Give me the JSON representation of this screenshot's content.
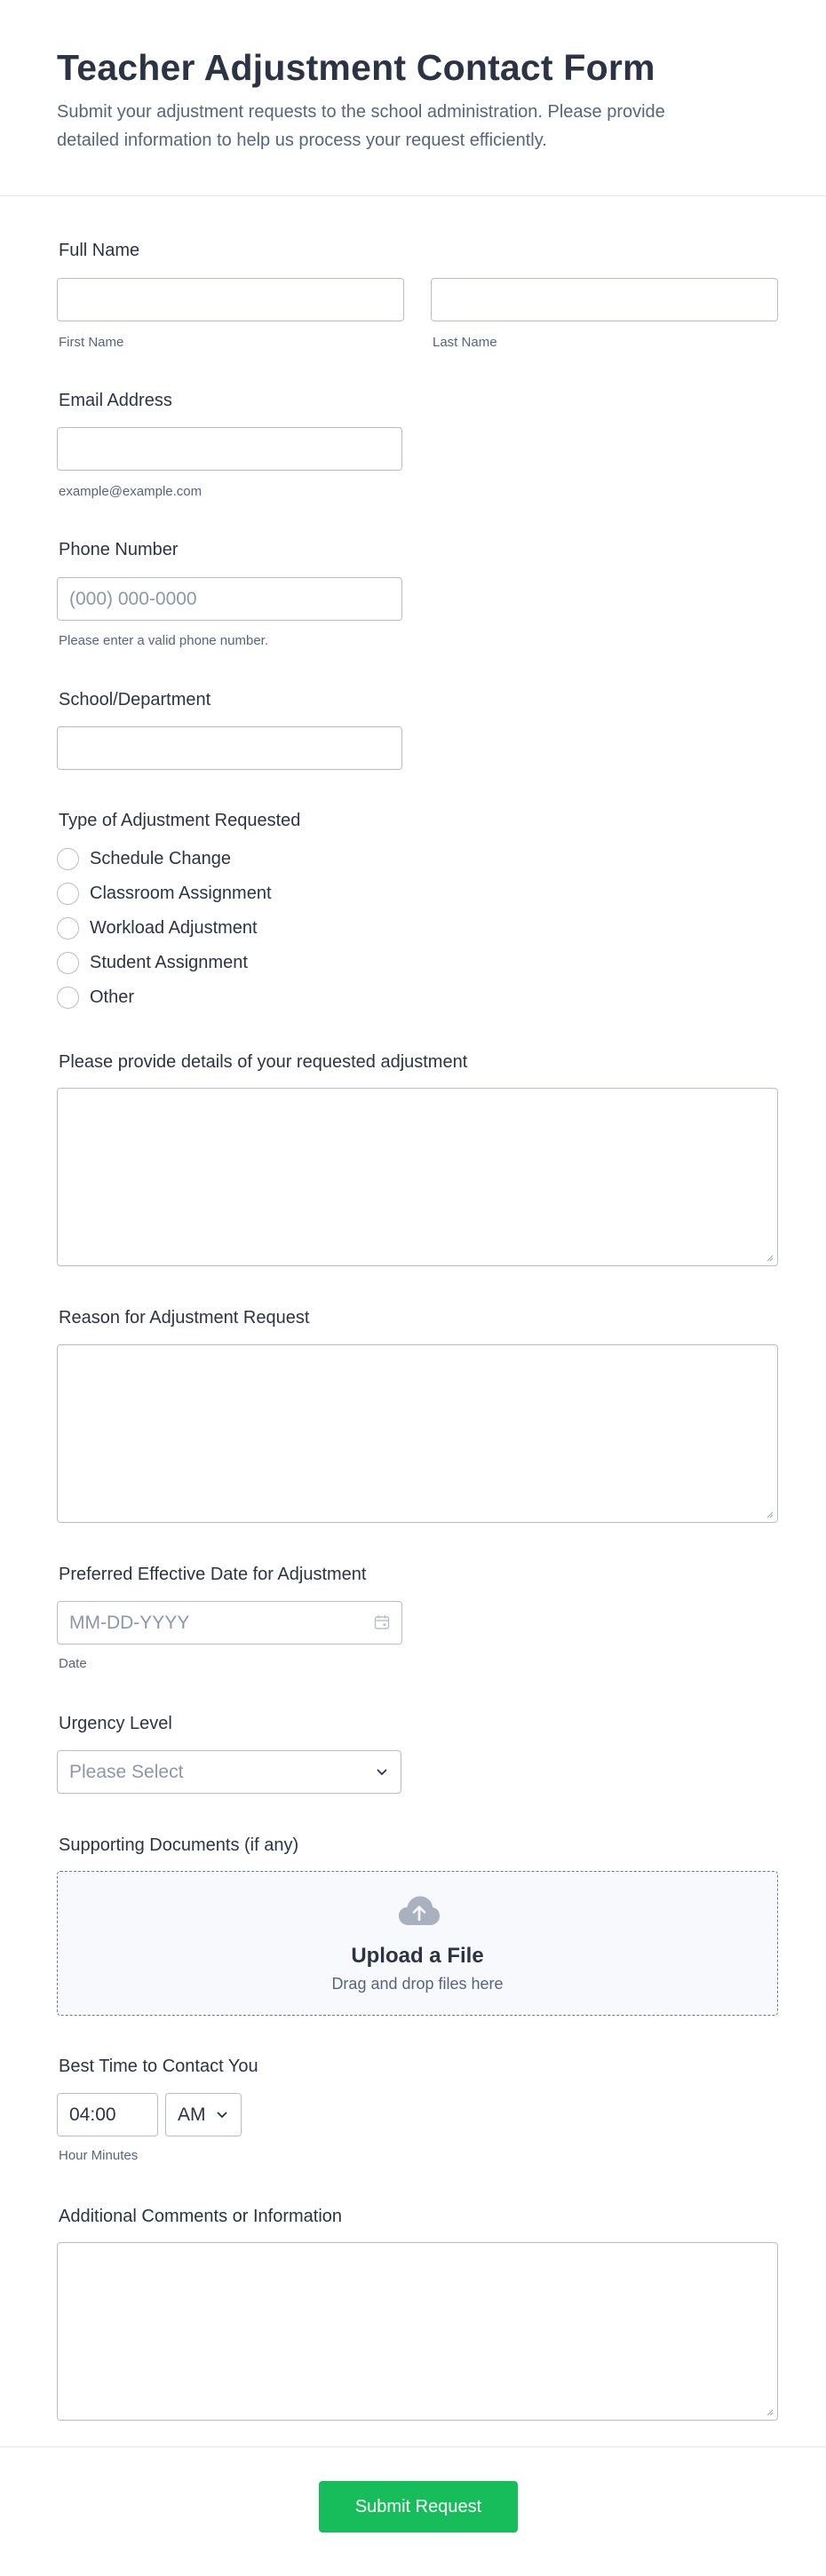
{
  "header": {
    "title": "Teacher Adjustment Contact Form",
    "description": "Submit your adjustment requests to the school administration. Please provide detailed information to help us process your request efficiently."
  },
  "fields": {
    "full_name": {
      "label": "Full Name",
      "first_sublabel": "First Name",
      "last_sublabel": "Last Name",
      "first_value": "",
      "last_value": ""
    },
    "email": {
      "label": "Email Address",
      "sublabel": "example@example.com",
      "value": ""
    },
    "phone": {
      "label": "Phone Number",
      "placeholder": "(000) 000-0000",
      "sublabel": "Please enter a valid phone number.",
      "value": ""
    },
    "school": {
      "label": "School/Department",
      "value": ""
    },
    "adjustment_type": {
      "label": "Type of Adjustment Requested",
      "options": [
        "Schedule Change",
        "Classroom Assignment",
        "Workload Adjustment",
        "Student Assignment",
        "Other"
      ],
      "selected": null
    },
    "details": {
      "label": "Please provide details of your requested adjustment",
      "value": ""
    },
    "reason": {
      "label": "Reason for Adjustment Request",
      "value": ""
    },
    "effective_date": {
      "label": "Preferred Effective Date for Adjustment",
      "placeholder": "MM-DD-YYYY",
      "sublabel": "Date",
      "icon": "calendar-icon"
    },
    "urgency": {
      "label": "Urgency Level",
      "selected": "Please Select",
      "icon": "chevron-down-icon"
    },
    "documents": {
      "label": "Supporting Documents (if any)",
      "upload_title": "Upload a File",
      "upload_hint": "Drag and drop files here",
      "icon": "cloud-upload-icon"
    },
    "contact_time": {
      "label": "Best Time to Contact You",
      "time_value": "04:00",
      "ampm": "AM",
      "sublabel": "Hour Minutes"
    },
    "comments": {
      "label": "Additional Comments or Information",
      "value": ""
    }
  },
  "submit": {
    "label": "Submit Request"
  },
  "colors": {
    "text": "#2c3345",
    "subtext": "#57647e",
    "border": "#b8bdc9",
    "placeholder": "#8d96aa",
    "submit_bg": "#18bd5b",
    "upload_bg": "#f8f9fd"
  }
}
